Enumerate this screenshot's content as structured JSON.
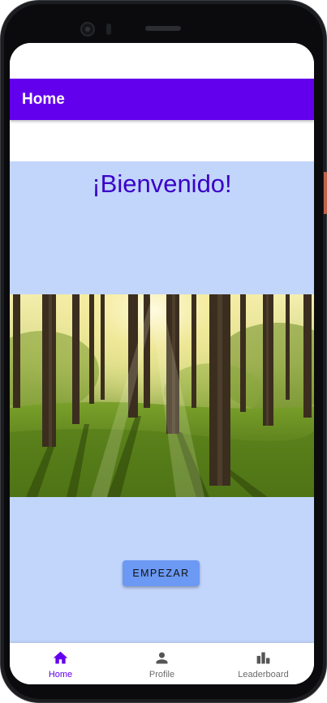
{
  "app_bar": {
    "title": "Home"
  },
  "main": {
    "welcome_text": "¡Bienvenido!",
    "image_alt": "forest-sunlight-image",
    "start_button_label": "EMPEZAR"
  },
  "bottom_nav": {
    "items": [
      {
        "label": "Home",
        "icon": "home-icon",
        "active": true
      },
      {
        "label": "Profile",
        "icon": "person-icon",
        "active": false
      },
      {
        "label": "Leaderboard",
        "icon": "bar-chart-icon",
        "active": false
      }
    ]
  },
  "colors": {
    "primary": "#6200ee",
    "content_background": "#c2d5fb",
    "welcome_text": "#3a00c8",
    "button": "#6c99f3",
    "inactive_nav": "#6b6b6b"
  }
}
